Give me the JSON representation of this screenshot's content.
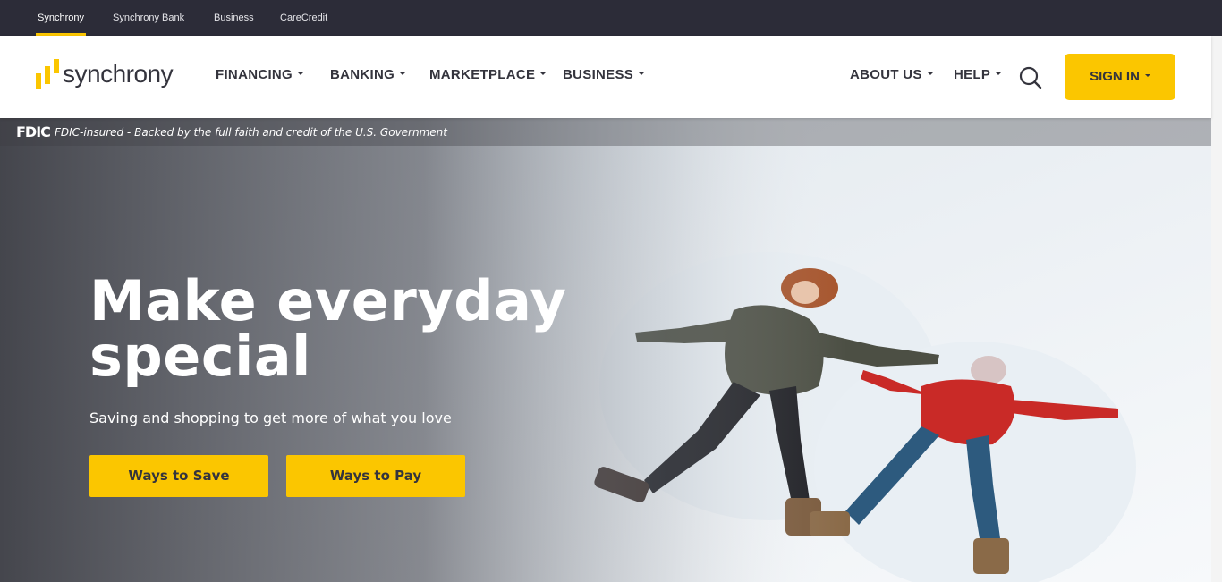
{
  "utility_nav": [
    {
      "label": "Synchrony",
      "active": true
    },
    {
      "label": "Synchrony Bank",
      "active": false
    },
    {
      "label": "Business",
      "active": false
    },
    {
      "label": "CareCredit",
      "active": false
    }
  ],
  "header": {
    "logo_text": "synchrony",
    "nav": [
      {
        "label": "FINANCING"
      },
      {
        "label": "BANKING"
      },
      {
        "label": "MARKETPLACE"
      },
      {
        "label": "BUSINESS"
      },
      {
        "label": "ABOUT US"
      },
      {
        "label": "HELP"
      }
    ],
    "search_icon": "search-icon",
    "sign_in_label": "SIGN IN"
  },
  "fdic": {
    "logo": "FDIC",
    "text": "FDIC-insured - Backed by the full faith and credit of the U.S. Government"
  },
  "hero": {
    "title": "Make everyday special",
    "subtitle": "Saving and shopping to get more of what you love",
    "buttons": [
      {
        "label": "Ways to Save"
      },
      {
        "label": "Ways to Pay"
      }
    ]
  },
  "colors": {
    "accent": "#fbc600",
    "utility_bar": "#2c2c38",
    "text_dark": "#34343d"
  }
}
